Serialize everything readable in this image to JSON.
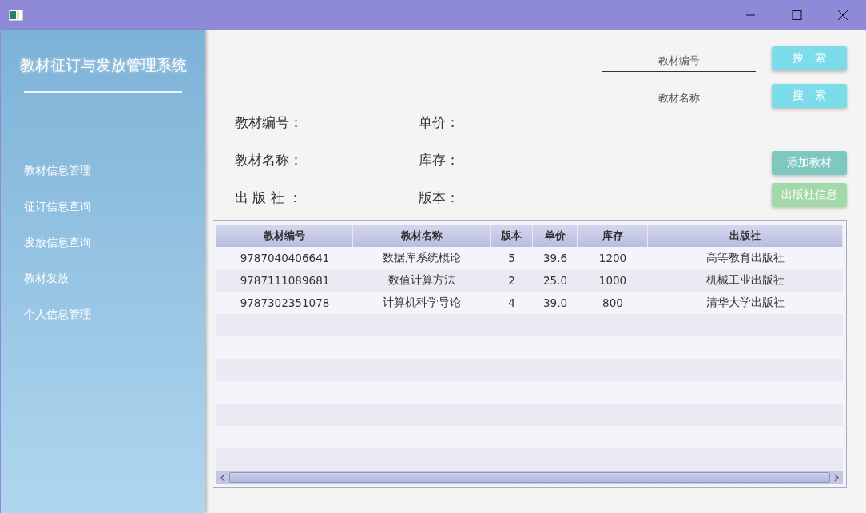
{
  "sidebar": {
    "title": "教材征订与发放管理系统",
    "items": [
      {
        "label": "教材信息管理"
      },
      {
        "label": "征订信息查询"
      },
      {
        "label": "发放信息查询"
      },
      {
        "label": "教材发放"
      },
      {
        "label": "个人信息管理"
      }
    ]
  },
  "search": [
    {
      "placeholder": "教材编号",
      "button": "搜　索"
    },
    {
      "placeholder": "教材名称",
      "button": "搜　索"
    }
  ],
  "form": {
    "left": [
      "教材编号：",
      "教材名称：",
      "出 版 社 ："
    ],
    "right": [
      "单价：",
      "库存：",
      "版本："
    ]
  },
  "actions": [
    {
      "label": "添加教材",
      "kind": "teal"
    },
    {
      "label": "出版社信息",
      "kind": "green"
    }
  ],
  "table": {
    "columns": [
      "教材编号",
      "教材名称",
      "版本",
      "单价",
      "库存",
      "出版社"
    ],
    "rows": [
      [
        "9787040406641",
        "数据库系统概论",
        "5",
        "39.6",
        "1200",
        "高等教育出版社"
      ],
      [
        "9787111089681",
        "数值计算方法",
        "2",
        "25.0",
        "1000",
        "机械工业出版社"
      ],
      [
        "9787302351078",
        "计算机科学导论",
        "4",
        "39.0",
        "800",
        "清华大学出版社"
      ]
    ]
  }
}
